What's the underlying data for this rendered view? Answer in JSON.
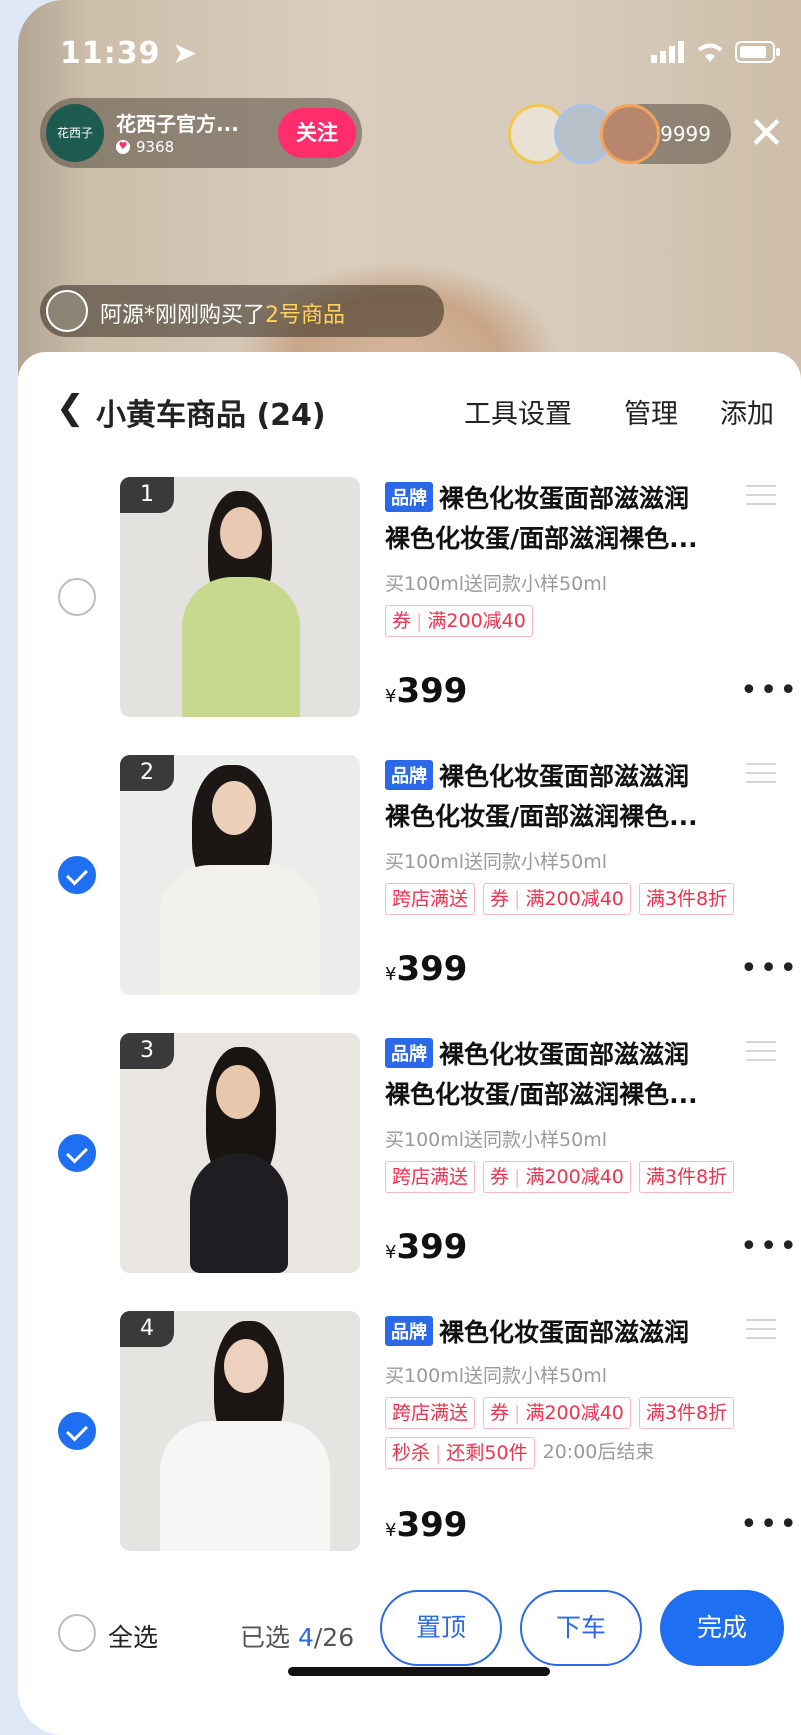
{
  "status_bar": {
    "time": "11:39"
  },
  "anchor": {
    "name": "花西子官方...",
    "likes": "9368",
    "avatar_text": "花西子",
    "follow_label": "关注"
  },
  "viewers": {
    "count": "9999"
  },
  "purchase_notice": {
    "prefix": "阿源*刚刚购买了",
    "highlight": "2号商品"
  },
  "sheet": {
    "title": "小黄车商品 (24)",
    "actions": [
      "工具设置",
      "管理",
      "添加"
    ]
  },
  "items": [
    {
      "num": "1",
      "brand_badge": "品牌",
      "title_line1": "裸色化妆蛋面部滋滋润",
      "title_line2": "裸色化妆蛋/面部滋润裸色...",
      "subtitle": "买100ml送同款小样50ml",
      "coupon_a": "券",
      "coupon_b": "满200减40",
      "currency": "¥",
      "price": "399",
      "selected": false,
      "image_color": "#c8d88f"
    },
    {
      "num": "2",
      "brand_badge": "品牌",
      "title_line1": "裸色化妆蛋面部滋滋润",
      "title_line2": "裸色化妆蛋/面部滋润裸色...",
      "subtitle": "买100ml送同款小样50ml",
      "tag_cross": "跨店满送",
      "coupon_a": "券",
      "coupon_b": "满200减40",
      "tag_discount": "满3件8折",
      "currency": "¥",
      "price": "399",
      "selected": true,
      "image_color": "#f2f1ec"
    },
    {
      "num": "3",
      "brand_badge": "品牌",
      "title_line1": "裸色化妆蛋面部滋滋润",
      "title_line2": "裸色化妆蛋/面部滋润裸色...",
      "subtitle": "买100ml送同款小样50ml",
      "tag_cross": "跨店满送",
      "coupon_a": "券",
      "coupon_b": "满200减40",
      "tag_discount": "满3件8折",
      "currency": "¥",
      "price": "399",
      "selected": true,
      "image_color": "#1e1e22"
    },
    {
      "num": "4",
      "brand_badge": "品牌",
      "title_line1": "裸色化妆蛋面部滋滋润",
      "subtitle": "买100ml送同款小样50ml",
      "tag_cross": "跨店满送",
      "coupon_a": "券",
      "coupon_b": "满200减40",
      "tag_discount": "满3件8折",
      "flash_a": "秒杀",
      "flash_b": "还剩50件",
      "flash_note": "20:00后结束",
      "currency": "¥",
      "price": "399",
      "selected": true,
      "image_color": "#f6f6f4"
    }
  ],
  "footer": {
    "select_all": "全选",
    "selected_prefix": "已选 ",
    "selected_num": "4",
    "selected_total": "/26",
    "pin_label": "置顶",
    "remove_label": "下车",
    "done_label": "完成"
  },
  "colors": {
    "accent": "#1f6ff2",
    "follow": "#ff2d6b",
    "tag": "#f0334e"
  }
}
